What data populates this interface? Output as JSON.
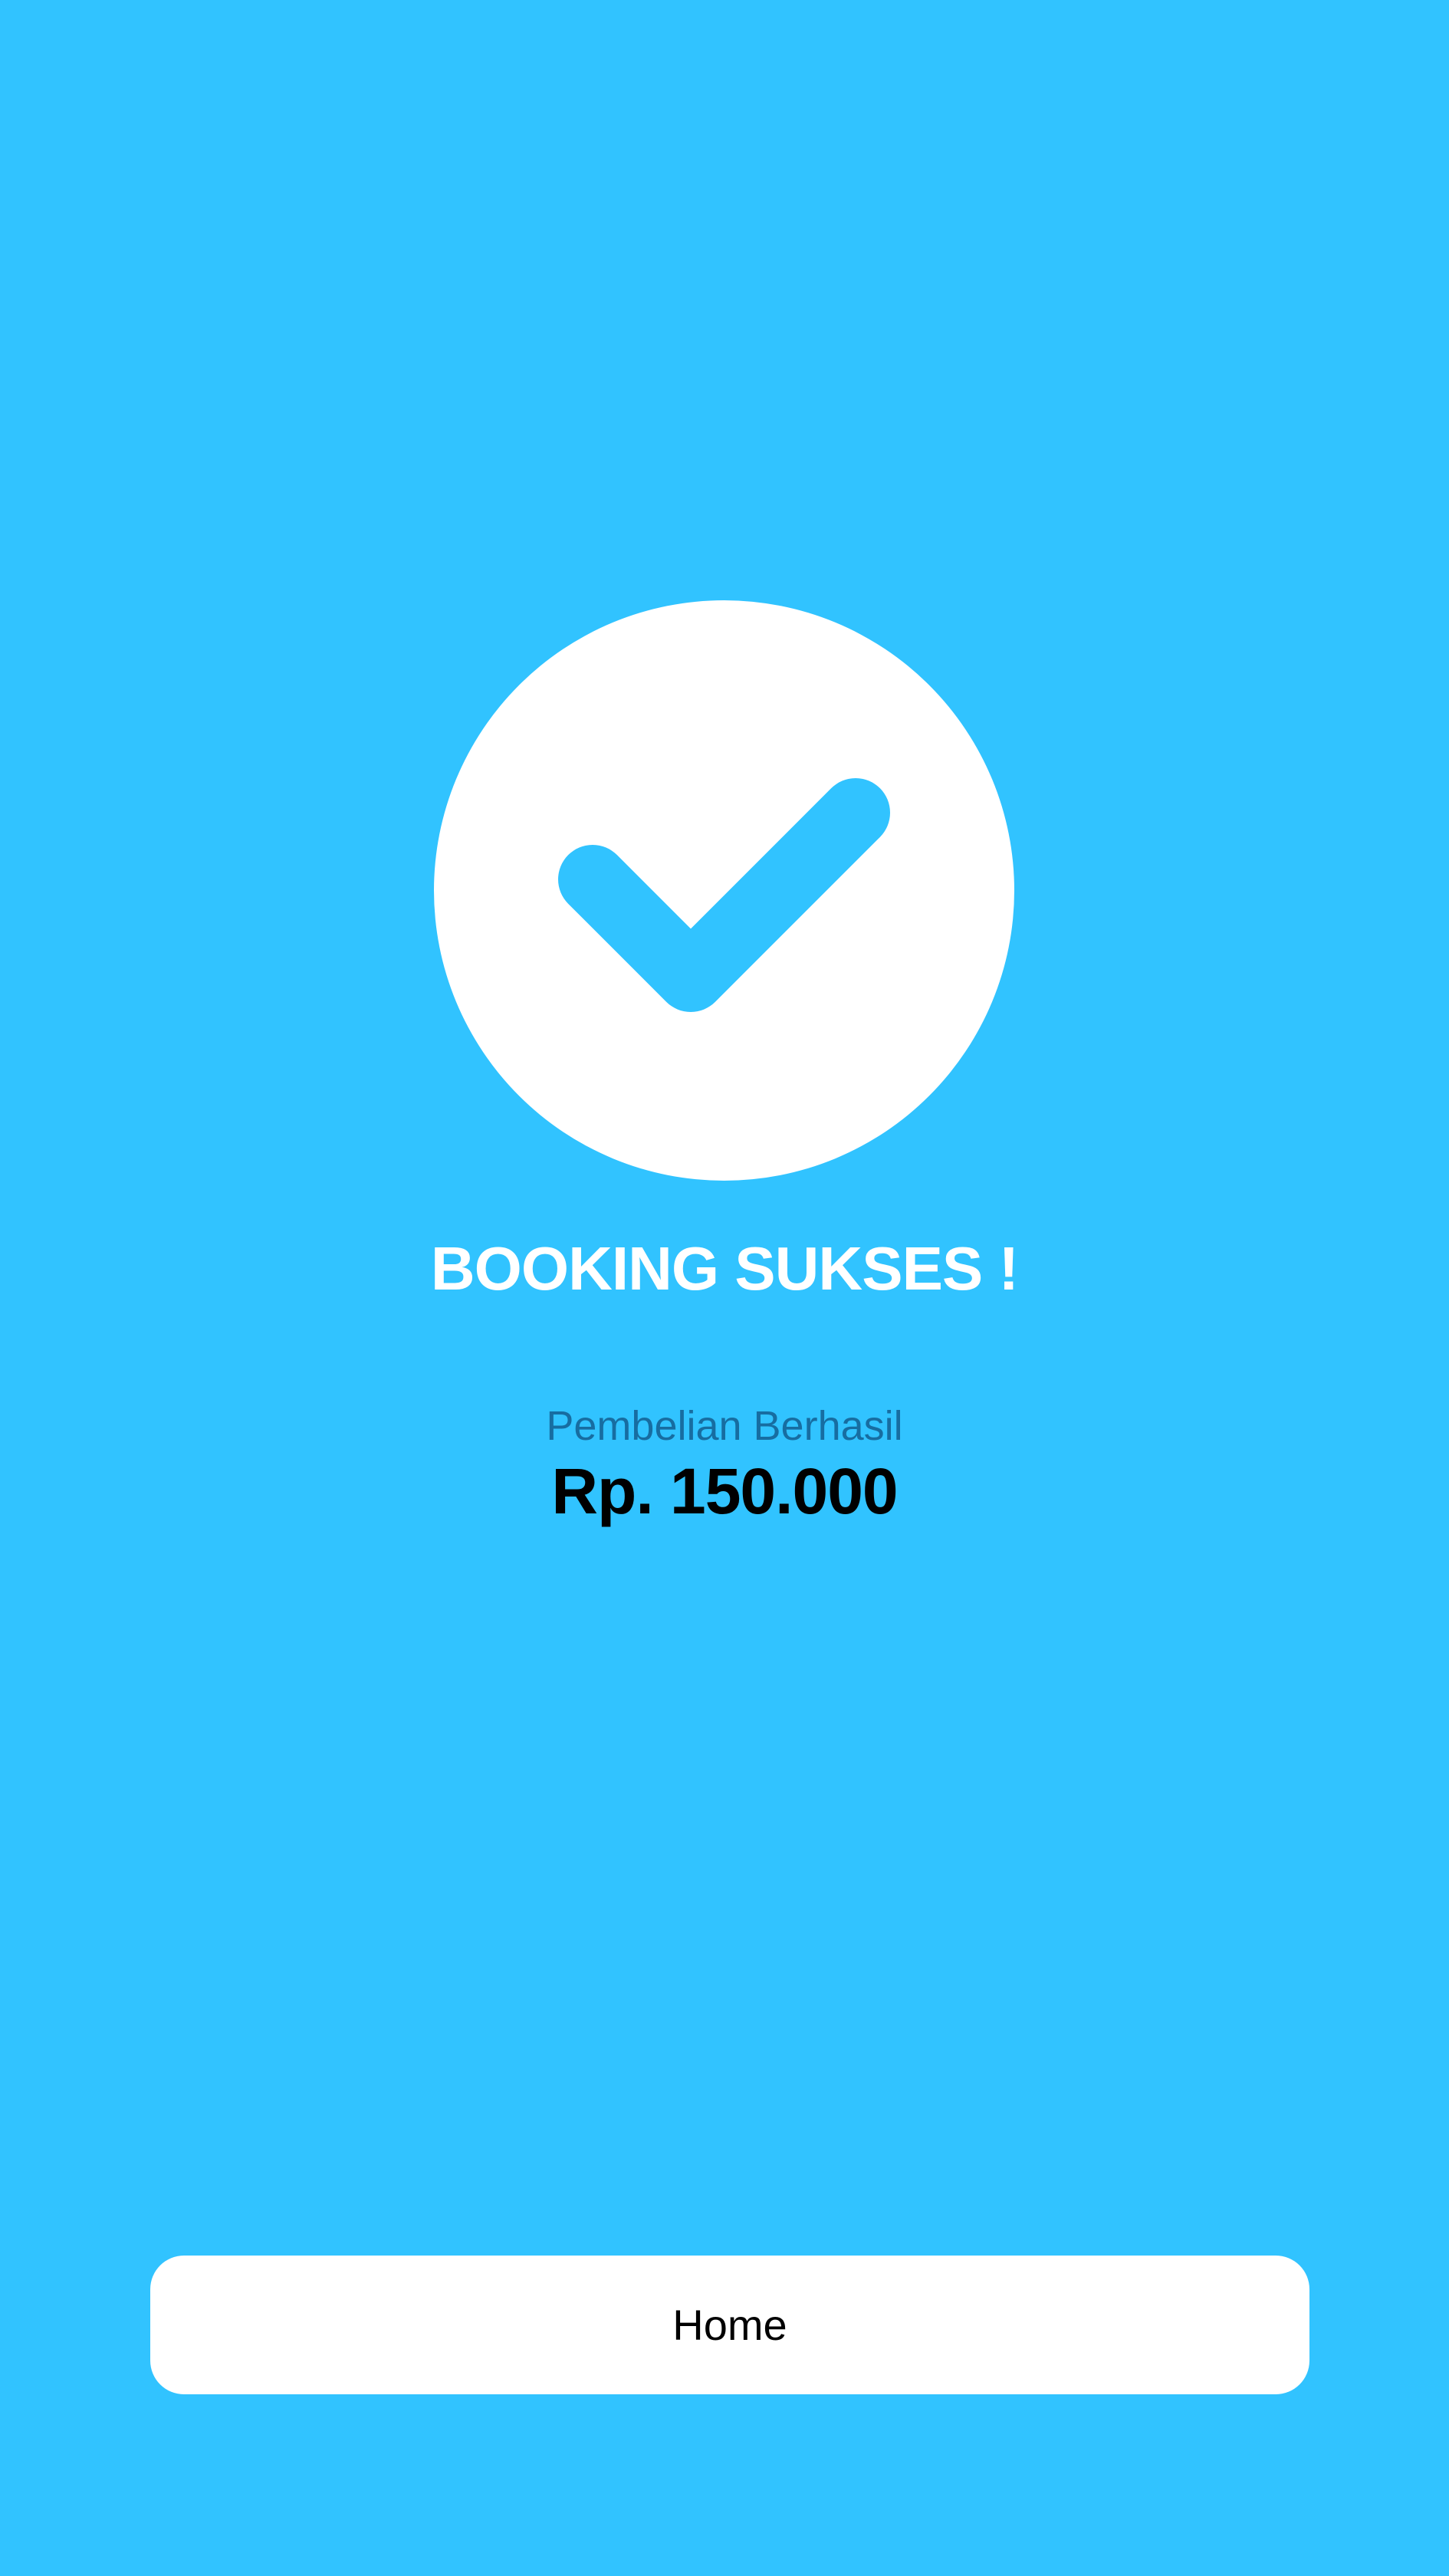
{
  "status": {
    "icon": "check-circle-icon",
    "title": "BOOKING SUKSES !",
    "subtitle": "Pembelian Berhasil",
    "amount": "Rp. 150.000"
  },
  "actions": {
    "home_label": "Home"
  },
  "colors": {
    "background": "#31C3FF",
    "badge": "#FFFFFF",
    "check": "#31C3FF",
    "subtitle": "#176DA1",
    "amount": "#000000",
    "button": "#FFFFFF",
    "button_text": "#000000"
  }
}
